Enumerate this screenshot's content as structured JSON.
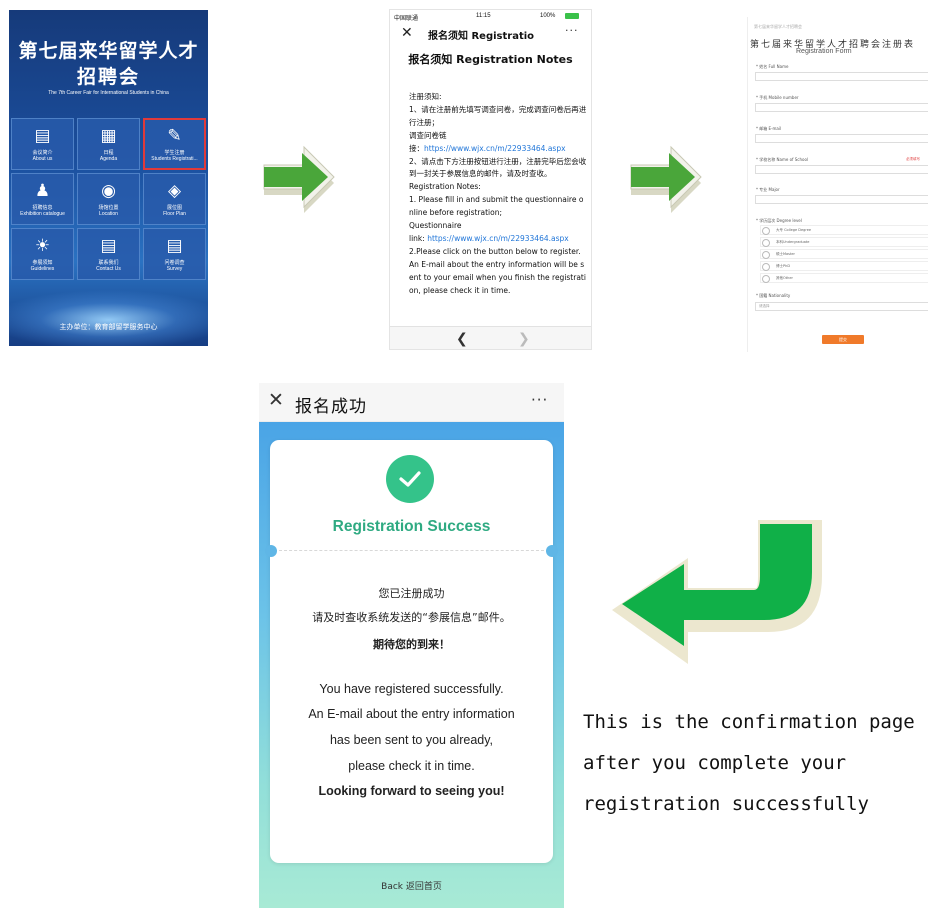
{
  "panel1": {
    "title_line1": "第七届来华留学人才",
    "title_line2": "招聘会",
    "subtitle": "The 7th Career Fair for International Students in China",
    "tiles": [
      {
        "cn": "会议简介",
        "en": "About us",
        "icon": "clipboard-icon"
      },
      {
        "cn": "日程",
        "en": "Agenda",
        "icon": "calendar-icon"
      },
      {
        "cn": "学生注册",
        "en": "Students Registrati...",
        "icon": "pen-icon"
      },
      {
        "cn": "招聘信息",
        "en": "Exhibition catalogue",
        "icon": "people-icon"
      },
      {
        "cn": "场馆位置",
        "en": "Location",
        "icon": "location-icon"
      },
      {
        "cn": "展位图",
        "en": "Floor Plan",
        "icon": "layers-icon"
      },
      {
        "cn": "参展须知",
        "en": "Guidelines",
        "icon": "bulb-icon"
      },
      {
        "cn": "联系我们",
        "en": "Contact Us",
        "icon": "contact-icon"
      },
      {
        "cn": "问卷调查",
        "en": "Survey",
        "icon": "list-icon"
      }
    ],
    "footer": "主办单位：教育部留学服务中心"
  },
  "panel2": {
    "carrier": "中国联通",
    "time": "11:15",
    "battery": "100%",
    "nav_title": "报名须知 Registratio",
    "title": "报名须知 Registration Notes",
    "lines": [
      "注册须知:",
      "1、请在注册前先填写调查问卷，完成调查问卷后再进行注册；",
      "    调查问卷链",
      "接：",
      "https://www.wjx.cn/m/22933464.aspx",
      "2、请点击下方注册按钮进行注册，注册完毕后您会收到一封关于参展信息的邮件，请及时查收。",
      "Registration Notes:",
      "1. Please fill in and submit the questionnaire online before registration;",
      "    Questionnaire",
      "link:",
      "https://www.wjx.cn/m/22933464.aspx",
      "2.Please click on the button below to register. An E-mail about the entry information will be sent to your email when you finish the registration, please check it in time."
    ]
  },
  "panel3": {
    "top_small": "第七届来华留学人才招聘会",
    "title": "第七届来华留学人才招聘会注册表",
    "subtitle": "Registration Form",
    "fields": [
      "* 姓名 Full Name",
      "* 手机 Mobile number",
      "* 邮箱 E-mail",
      "* 学校名称 Name of School",
      "* 专业 Major",
      "* 学历层次 Degree level",
      "* 国籍 Nationality"
    ],
    "required_note": "必须填写",
    "degree_options": [
      "大专 College Degree",
      "本科Undergraduate",
      "硕士Master",
      "博士PhD",
      "其他Other"
    ],
    "select_placeholder": "请选择",
    "submit": "提交"
  },
  "panel4": {
    "header_title": "报名成功",
    "success": "Registration Success",
    "cn_line1": "您已注册成功",
    "cn_line2": "请及时查收系统发送的“参展信息”邮件。",
    "cn_line3": "期待您的到来！",
    "en_line1": "You have registered successfully.",
    "en_line2": "An E-mail about the entry information",
    "en_line3": "has been sent to you already,",
    "en_line4": "please check it in time.",
    "en_line5": "Looking forward to seeing you!",
    "back": "Back 返回首页"
  },
  "caption": {
    "line1": "This is the confirmation page",
    "line2": "after you complete your",
    "line3": "registration successfully"
  },
  "colors": {
    "arrow_green": "#4aa63a",
    "curve_arrow_green": "#10b048",
    "success_green": "#2faa82",
    "link_blue": "#2176d8",
    "selected_tile_border": "#e03a3a",
    "submit_orange": "#f07a2a"
  }
}
